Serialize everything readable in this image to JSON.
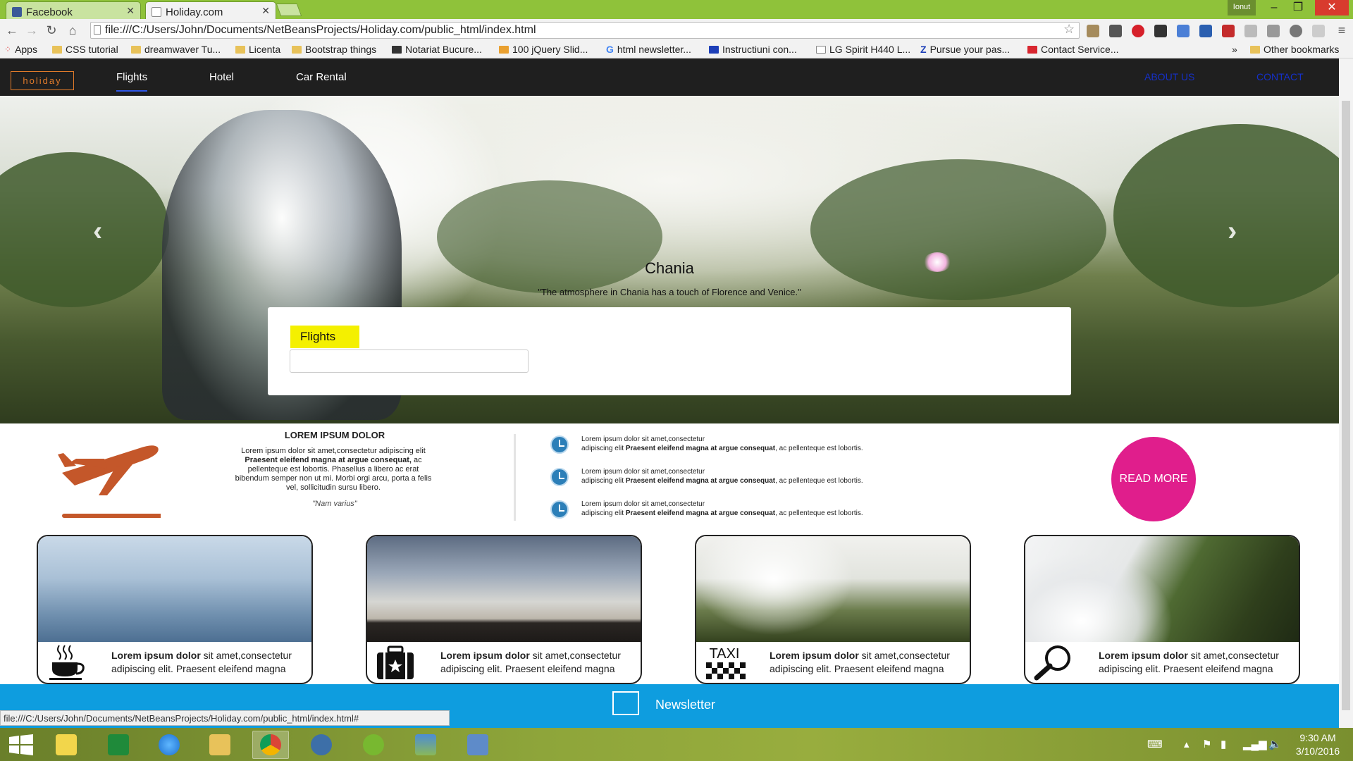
{
  "browser": {
    "tabs": [
      {
        "title": "Facebook",
        "active": false
      },
      {
        "title": "Holiday.com",
        "active": true
      }
    ],
    "profile_name": "Ionut",
    "url": "file:///C:/Users/John/Documents/NetBeansProjects/Holiday.com/public_html/index.html",
    "status_url": "file:///C:/Users/John/Documents/NetBeansProjects/Holiday.com/public_html/index.html#",
    "bookmarks": [
      "Apps",
      "CSS tutorial",
      "dreamwaver Tu...",
      "Licenta",
      "Bootstrap things",
      "Notariat Bucure...",
      "100 jQuery Slid...",
      "html newsletter...",
      "Instructiuni con...",
      "LG Spirit H440 L...",
      "Pursue your pas...",
      "Contact Service..."
    ],
    "bookmarks_overflow": "»",
    "other_bookmarks": "Other bookmarks"
  },
  "site": {
    "logo": "holiday",
    "nav": {
      "items": [
        "Flights",
        "Hotel",
        "Car Rental"
      ],
      "active": "Flights",
      "right": [
        "ABOUT US",
        "CONTACT"
      ]
    },
    "hero": {
      "title": "Chania",
      "caption": "\"The atmosphere in Chania has a touch of Florence and Venice.\"",
      "prev": "‹",
      "next": "›"
    },
    "search": {
      "tab": "Flights",
      "input_value": ""
    },
    "info": {
      "title": "LOREM IPSUM DOLOR",
      "body_pre": "Lorem ipsum dolor sit amet,consectetur adipiscing elit ",
      "body_bold": "Praesent eleifend magna at argue consequat,",
      "body_post": " ac pellenteque est lobortis. Phasellus a libero ac erat bibendum semper non ut mi. Morbi orgi arcu, porta a felis vel, sollicitudin sursu libero.",
      "quote": "\"Nam varius\""
    },
    "features": [
      {
        "line1": "Lorem ipsum dolor sit amet,consectetur",
        "pre": "adipiscing elit ",
        "bold": "Praesent eleifend magna at argue consequat",
        "post": ", ac pellenteque est lobortis."
      },
      {
        "line1": "Lorem ipsum dolor sit amet,consectetur",
        "pre": "adipiscing elit ",
        "bold": "Praesent eleifend magna at argue consequat",
        "post": ", ac pellenteque est lobortis."
      },
      {
        "line1": "Lorem ipsum dolor sit amet,consectetur",
        "pre": "adipiscing elit ",
        "bold": "Praesent eleifend magna at argue consequat",
        "post": ", ac pellenteque est lobortis."
      }
    ],
    "read_more": "READ MORE",
    "cards": [
      {
        "icon": "coffee-icon",
        "bold": "Lorem ipsum dolor",
        "text": " sit amet,consectetur adipiscing elit. Praesent eleifend magna"
      },
      {
        "icon": "suitcase-icon",
        "bold": "Lorem ipsum dolor",
        "text": " sit amet,consectetur adipiscing elit. Praesent eleifend magna"
      },
      {
        "icon": "taxi-icon",
        "icon_label": "TAXI",
        "bold": "Lorem ipsum dolor",
        "text": " sit amet,consectetur adipiscing elit. Praesent eleifend magna"
      },
      {
        "icon": "magnifier-icon",
        "bold": "Lorem ipsum dolor",
        "text": " sit amet,consectetur adipiscing elit. Praesent eleifend magna"
      }
    ],
    "newsletter": "Newsletter"
  },
  "colors": {
    "nav_bg": "#1f1f1f",
    "logo": "#e07a2a",
    "nav_right_link": "#1530c9",
    "flights_tab": "#f4f000",
    "plane": "#c4572a",
    "clock_icon": "#2c7fb8",
    "read_more": "#e01e8c",
    "newsletter_bar": "#0e9ddf"
  },
  "taskbar": {
    "time": "9:30 AM",
    "date": "3/10/2016"
  }
}
